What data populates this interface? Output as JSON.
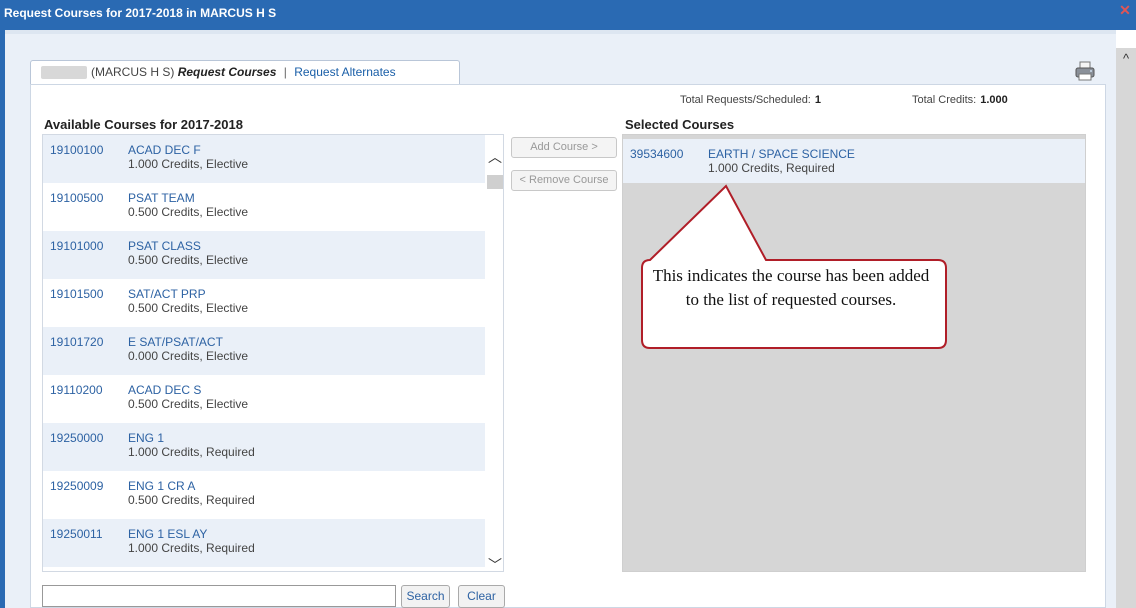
{
  "window": {
    "title": "Request Courses for 2017-2018 in MARCUS H S"
  },
  "tabs": {
    "school": "(MARCUS H S)",
    "active_tab": "Request Courses",
    "separator": "|",
    "alternates_tab": "Request Alternates"
  },
  "totals": {
    "requests_label": "Total Requests/Scheduled:",
    "requests_value": "1",
    "credits_label": "Total Credits:",
    "credits_value": "1.000"
  },
  "available": {
    "heading": "Available Courses for 2017-2018",
    "courses": [
      {
        "code": "19100100",
        "title": "ACAD DEC F",
        "credits": "1.000 Credits,  Elective"
      },
      {
        "code": "19100500",
        "title": "PSAT TEAM",
        "credits": "0.500 Credits,  Elective"
      },
      {
        "code": "19101000",
        "title": "PSAT CLASS",
        "credits": "0.500 Credits,  Elective"
      },
      {
        "code": "19101500",
        "title": "SAT/ACT PRP",
        "credits": "0.500 Credits,  Elective"
      },
      {
        "code": "19101720",
        "title": "E SAT/PSAT/ACT",
        "credits": "0.000 Credits,  Elective"
      },
      {
        "code": "19110200",
        "title": "ACAD DEC S",
        "credits": "0.500 Credits,  Elective"
      },
      {
        "code": "19250000",
        "title": "ENG 1",
        "credits": "1.000 Credits,  Required"
      },
      {
        "code": "19250009",
        "title": "ENG 1 CR A",
        "credits": "0.500 Credits,  Required"
      },
      {
        "code": "19250011",
        "title": "ENG 1 ESL AY",
        "credits": "1.000 Credits,  Required"
      }
    ]
  },
  "buttons": {
    "add": "Add Course >",
    "remove": "< Remove Course",
    "search": "Search",
    "clear": "Clear"
  },
  "selected": {
    "heading": "Selected Courses",
    "courses": [
      {
        "code": "39534600",
        "title": "EARTH / SPACE SCIENCE",
        "credits": "1.000 Credits,  Required"
      }
    ]
  },
  "callout": {
    "text": "This indicates the course has been added to the list of requested courses."
  },
  "search": {
    "value": ""
  },
  "icons": {
    "close": "close-icon",
    "printer": "printer-icon",
    "scroll_up": "chevron-up-icon",
    "scroll_down": "chevron-down-icon"
  }
}
